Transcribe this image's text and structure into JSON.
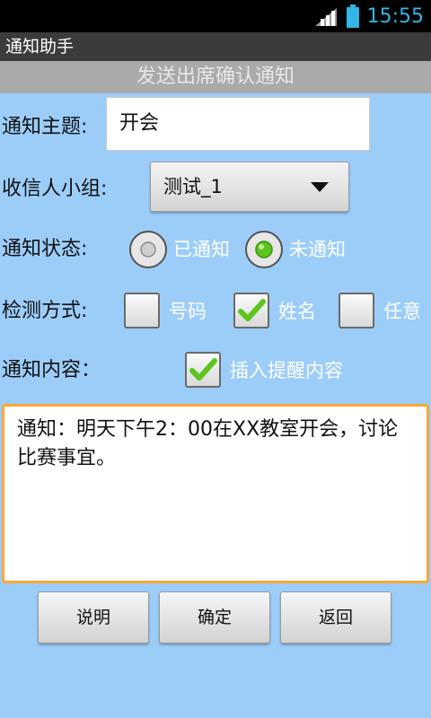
{
  "status_bar": {
    "time": "15:55",
    "icons": [
      "signal-icon",
      "battery-icon"
    ]
  },
  "app": {
    "title": "通知助手",
    "header": "发送出席确认通知"
  },
  "form": {
    "subject_label": "通知主题:",
    "subject_value": "开会",
    "group_label": "收信人小组:",
    "group_selected": "测试_1",
    "status_label": "通知状态:",
    "status_options": [
      {
        "label": "已通知",
        "selected": false
      },
      {
        "label": "未通知",
        "selected": true
      }
    ],
    "detect_label": "检测方式:",
    "detect_options": [
      {
        "label": "号码",
        "checked": false
      },
      {
        "label": "姓名",
        "checked": true
      },
      {
        "label": "任意",
        "checked": false
      }
    ],
    "content_label": "通知内容：",
    "insert_reminder_label": "插入提醒内容",
    "insert_reminder_checked": true,
    "content_text": "通知：明天下午2：00在XX教室开会，讨论比赛事宜。"
  },
  "buttons": {
    "explain": "说明",
    "confirm": "确定",
    "back": "返回"
  },
  "colors": {
    "background": "#9ccdf9",
    "focus_border": "#ffa732",
    "check_green": "#5cc51e",
    "time_blue": "#33b5e5"
  }
}
